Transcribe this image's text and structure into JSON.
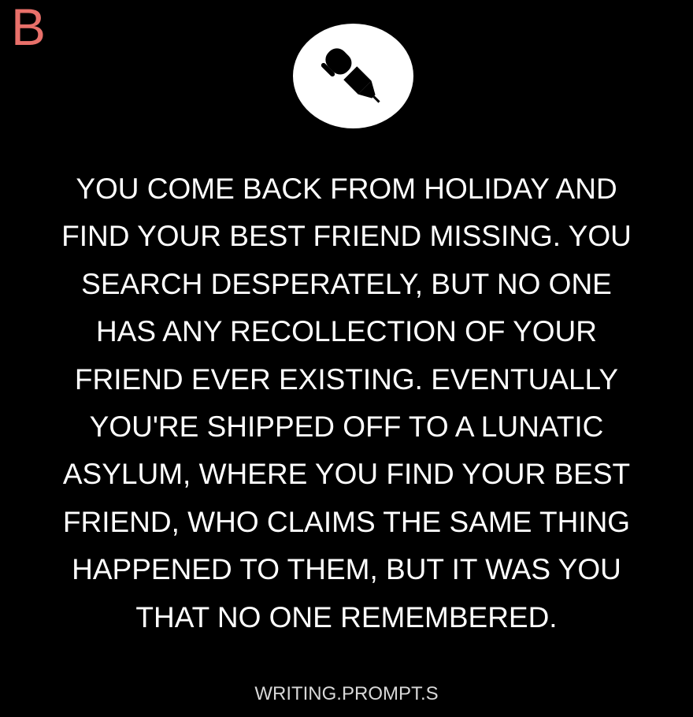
{
  "corner_letter": "B",
  "icon": "pen-icon",
  "prompt_lines": [
    "YOU COME BACK FROM HOLIDAY AND",
    "FIND YOUR BEST FRIEND MISSING. YOU",
    "SEARCH DESPERATELY, BUT NO ONE",
    "HAS ANY RECOLLECTION OF YOUR",
    "FRIEND EVER EXISTING. EVENTUALLY",
    "YOU'RE SHIPPED OFF TO A LUNATIC",
    "ASYLUM, WHERE YOU FIND YOUR BEST",
    "FRIEND, WHO CLAIMS THE SAME THING",
    "HAPPENED TO THEM, BUT IT WAS YOU",
    "THAT NO ONE REMEMBERED."
  ],
  "footer": "WRITING.PROMPT.S",
  "colors": {
    "background": "#000000",
    "text": "#ffffff",
    "corner_letter": "#e8706a",
    "badge": "#ffffff"
  }
}
